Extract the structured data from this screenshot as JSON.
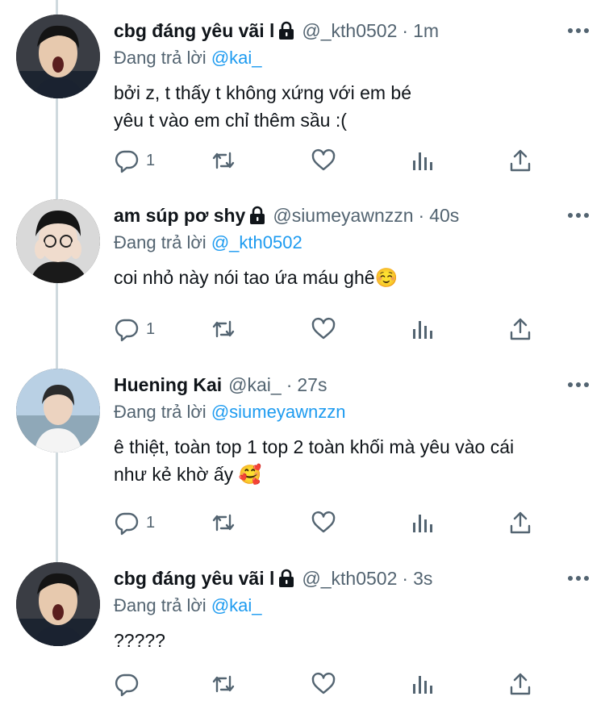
{
  "reply_prefix": "Đang trả lời",
  "tweets": [
    {
      "name": "cbg đáng yêu vãi l",
      "handle": "@_kth0502",
      "time": "1m",
      "reply_to": "@kai_",
      "text": "bởi z, t thấy t không xứng với em bé\nyêu t vào em chỉ thêm sầu :(",
      "reply_count": "1",
      "avatar_bg": "#2a2a2a"
    },
    {
      "name": "am súp pơ shy",
      "handle": "@siumeyawnzzn",
      "time": "40s",
      "reply_to": "@_kth0502",
      "text": "coi nhỏ này nói tao ứa máu ghê☺️",
      "reply_count": "1",
      "avatar_bg": "#d8d8d8"
    },
    {
      "name": "Huening Kai",
      "handle": "@kai_",
      "time": "27s",
      "reply_to": "@siumeyawnzzn",
      "text": "ê thiệt, toàn top 1 top 2 toàn khối mà yêu vào cái\nnhư kẻ khờ ấy 🥰",
      "reply_count": "1",
      "avatar_bg": "#a9c4dc"
    },
    {
      "name": "cbg đáng yêu vãi l",
      "handle": "@_kth0502",
      "time": "3s",
      "reply_to": "@kai_",
      "text": "?????",
      "reply_count": "",
      "avatar_bg": "#2a2a2a"
    }
  ],
  "icons": {
    "reply": "reply-icon",
    "retweet": "retweet-icon",
    "like": "heart-icon",
    "views": "views-icon",
    "share": "share-icon",
    "more": "more-icon",
    "protected": "lock-icon"
  },
  "colors": {
    "link": "#1d9bf0",
    "secondary": "#536471",
    "text": "#0f1419",
    "thread_line": "#cfd9de"
  }
}
